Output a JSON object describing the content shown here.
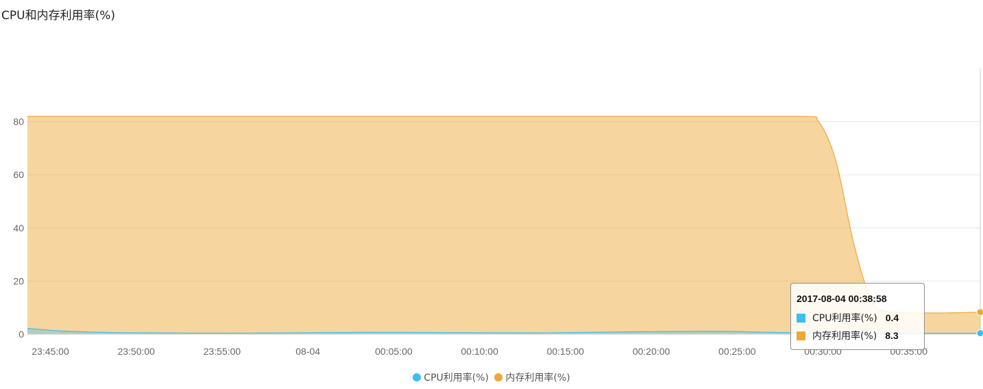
{
  "title": "CPU和内存利用率(%)",
  "chart_data": {
    "type": "area",
    "title": "CPU和内存利用率(%)",
    "xlabel": "",
    "ylabel": "",
    "ylim": [
      0,
      100
    ],
    "y_ticks": [
      0,
      20,
      40,
      60,
      80
    ],
    "x_ticks": [
      {
        "t": 0,
        "label": "23:45:00"
      },
      {
        "t": 5,
        "label": "23:50:00"
      },
      {
        "t": 10,
        "label": "23:55:00"
      },
      {
        "t": 15,
        "label": "08-04"
      },
      {
        "t": 20,
        "label": "00:05:00"
      },
      {
        "t": 25,
        "label": "00:10:00"
      },
      {
        "t": 30,
        "label": "00:15:00"
      },
      {
        "t": 35,
        "label": "00:20:00"
      },
      {
        "t": 40,
        "label": "00:25:00"
      },
      {
        "t": 45,
        "label": "00:30:00"
      },
      {
        "t": 50,
        "label": "00:35:00"
      }
    ],
    "x_range": [
      -0.1,
      55.4
    ],
    "grid": true,
    "legend_position": "bottom-center",
    "series": [
      {
        "name": "CPU利用率(%)",
        "color": "#3dbdf0",
        "points": [
          [
            -0.1,
            2.2
          ],
          [
            2,
            1.2
          ],
          [
            5,
            0.6
          ],
          [
            10,
            0.4
          ],
          [
            15,
            0.5
          ],
          [
            20,
            0.7
          ],
          [
            25,
            0.6
          ],
          [
            30,
            0.5
          ],
          [
            35,
            0.9
          ],
          [
            40,
            1.1
          ],
          [
            45,
            0.5
          ],
          [
            50,
            0.4
          ],
          [
            55.4,
            0.4
          ]
        ]
      },
      {
        "name": "内存利用率(%)",
        "color": "#efa73a",
        "points": [
          [
            -0.1,
            82
          ],
          [
            5,
            82
          ],
          [
            10,
            82
          ],
          [
            15,
            82
          ],
          [
            20,
            82
          ],
          [
            25,
            82
          ],
          [
            30,
            82
          ],
          [
            35,
            82
          ],
          [
            40,
            82
          ],
          [
            45.2,
            82
          ],
          [
            46,
            80
          ],
          [
            47,
            65
          ],
          [
            48,
            35
          ],
          [
            49,
            14
          ],
          [
            50,
            8.5
          ],
          [
            53,
            8.0
          ],
          [
            55.4,
            8.3
          ]
        ]
      }
    ]
  },
  "tooltip": {
    "time": "2017-08-04 00:38:58",
    "rows": [
      {
        "name": "CPU利用率(%)",
        "value": "0.4",
        "color": "#3dbdf0"
      },
      {
        "name": "内存利用率(%)",
        "value": "8.3",
        "color": "#efa73a"
      }
    ]
  },
  "legend": [
    {
      "name": "CPU利用率(%)",
      "color": "#3dbdf0"
    },
    {
      "name": "内存利用率(%)",
      "color": "#efa73a"
    }
  ]
}
